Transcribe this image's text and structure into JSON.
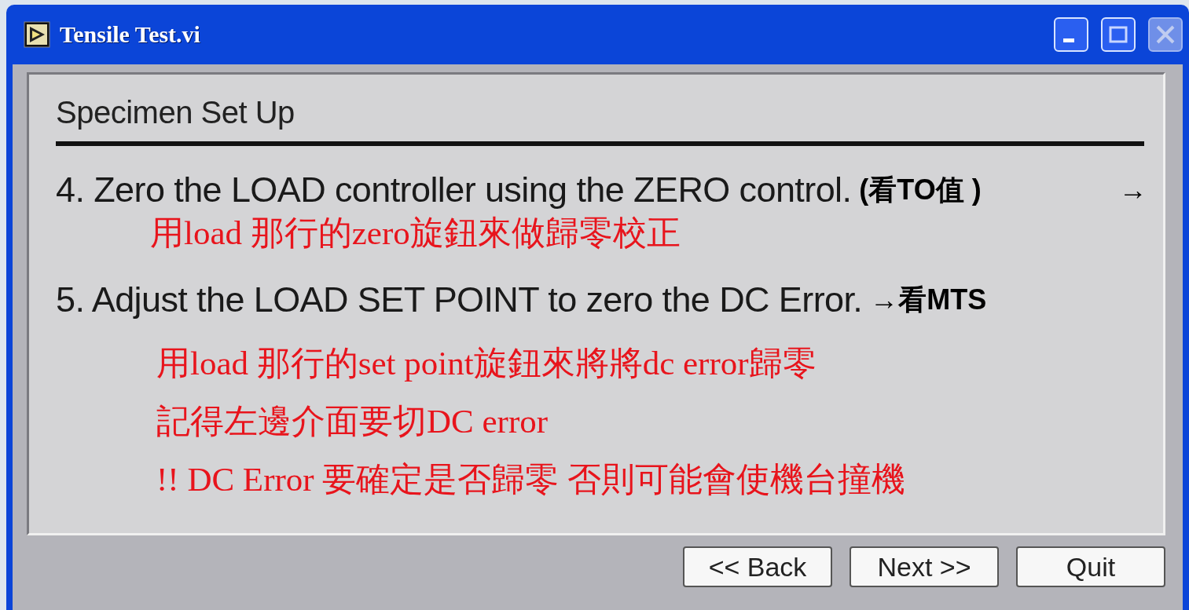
{
  "window": {
    "title": "Tensile Test.vi"
  },
  "panel": {
    "heading": "Specimen Set Up",
    "steps": [
      {
        "text": "4. Zero the LOAD controller using the ZERO control.",
        "annotation": "(看TO值 )",
        "arrow": "→",
        "notes": [
          "用load 那行的zero旋鈕來做歸零校正"
        ]
      },
      {
        "text": "5. Adjust the LOAD SET POINT to zero the DC Error.",
        "annotation": "→看MTS",
        "notes": [
          "用load 那行的set point旋鈕來將將dc error歸零",
          "記得左邊介面要切DC error",
          "!! DC Error 要確定是否歸零 否則可能會使機台撞機"
        ]
      }
    ]
  },
  "buttons": [
    "<< Back",
    "Next >>",
    "Quit"
  ]
}
